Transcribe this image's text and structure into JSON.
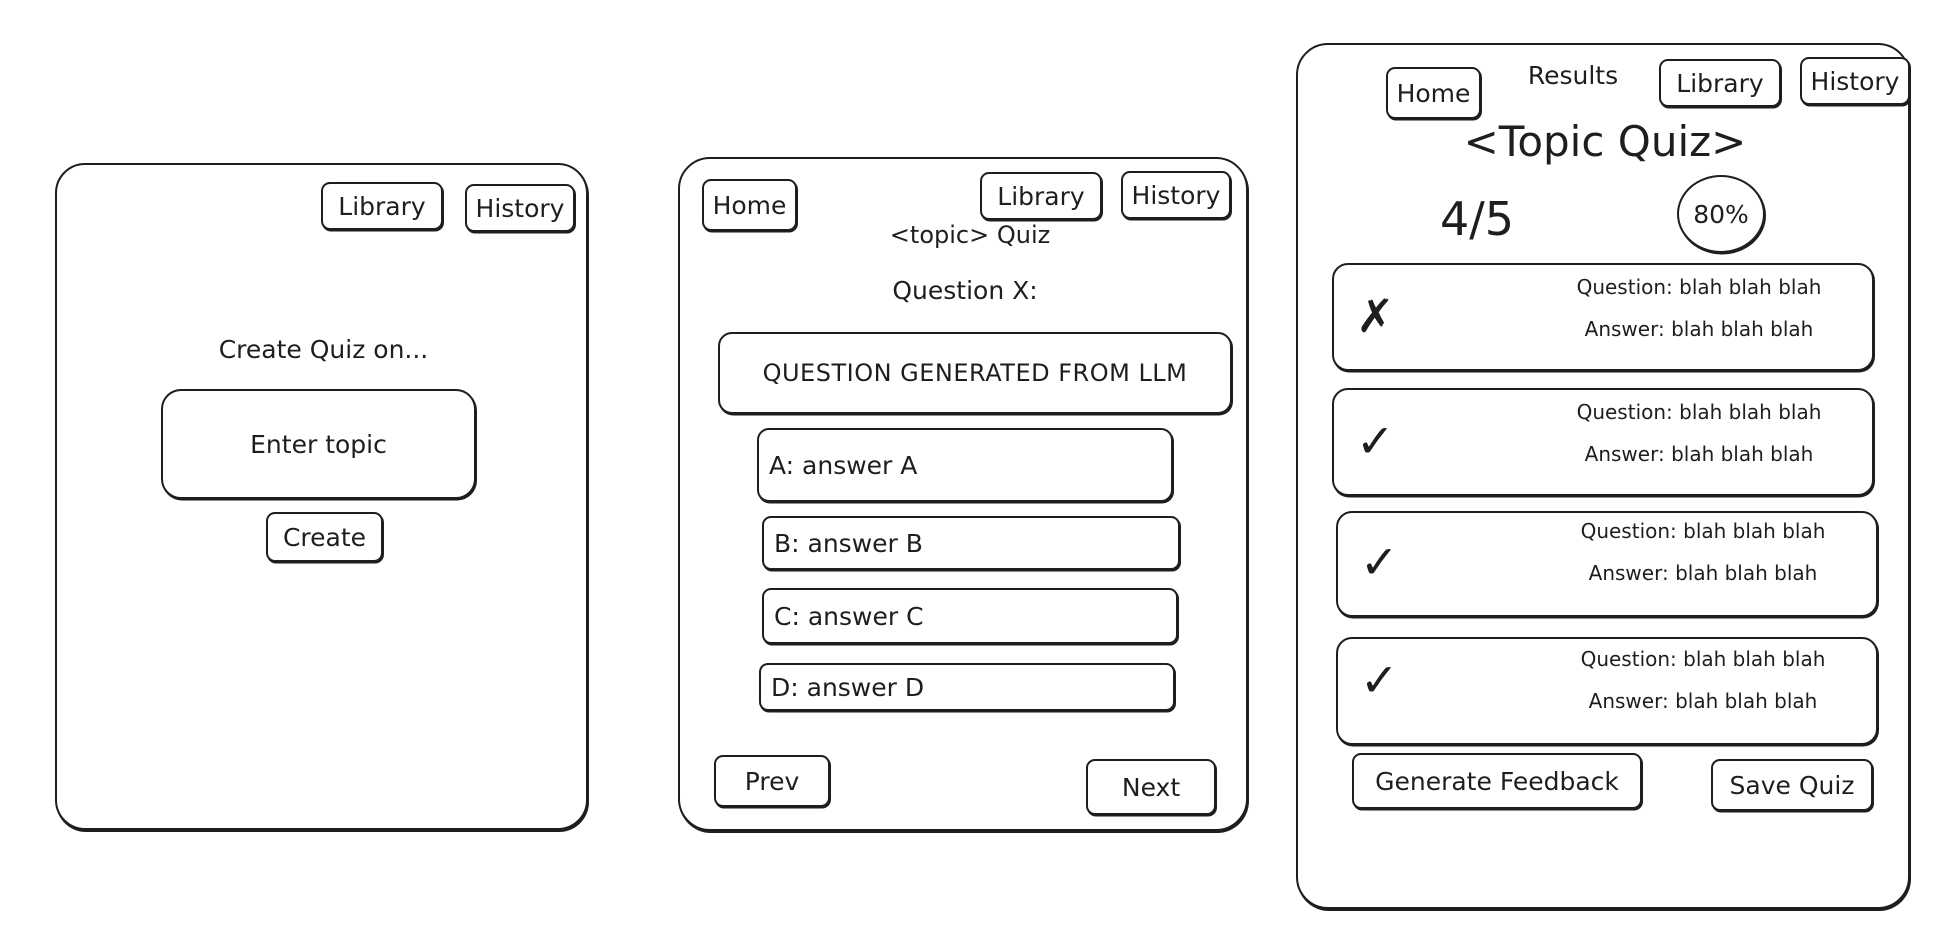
{
  "create_screen": {
    "nav": {
      "library": "Library",
      "history": "History"
    },
    "heading": "Create Quiz on...",
    "topic_placeholder": "Enter topic",
    "create_button": "Create"
  },
  "quiz_screen": {
    "nav": {
      "home": "Home",
      "library": "Library",
      "history": "History"
    },
    "title": "<topic> Quiz",
    "question_label": "Question X:",
    "question_text": "QUESTION GENERATED FROM LLM",
    "answers": [
      "A: answer A",
      "B: answer B",
      "C: answer C",
      "D: answer D"
    ],
    "prev_button": "Prev",
    "next_button": "Next"
  },
  "results_screen": {
    "nav": {
      "home": "Home",
      "library": "Library",
      "history": "History"
    },
    "label": "Results",
    "title": "<Topic Quiz>",
    "score": "4/5",
    "percent": "80%",
    "results": [
      {
        "mark": "✗",
        "correct": false,
        "question": "Question: blah blah blah",
        "answer": "Answer: blah blah blah"
      },
      {
        "mark": "✓",
        "correct": true,
        "question": "Question: blah blah blah",
        "answer": "Answer: blah blah blah"
      },
      {
        "mark": "✓",
        "correct": true,
        "question": "Question: blah blah blah",
        "answer": "Answer: blah blah blah"
      },
      {
        "mark": "✓",
        "correct": true,
        "question": "Question: blah blah blah",
        "answer": "Answer: blah blah blah"
      }
    ],
    "generate_feedback_button": "Generate Feedback",
    "save_quiz_button": "Save Quiz"
  }
}
